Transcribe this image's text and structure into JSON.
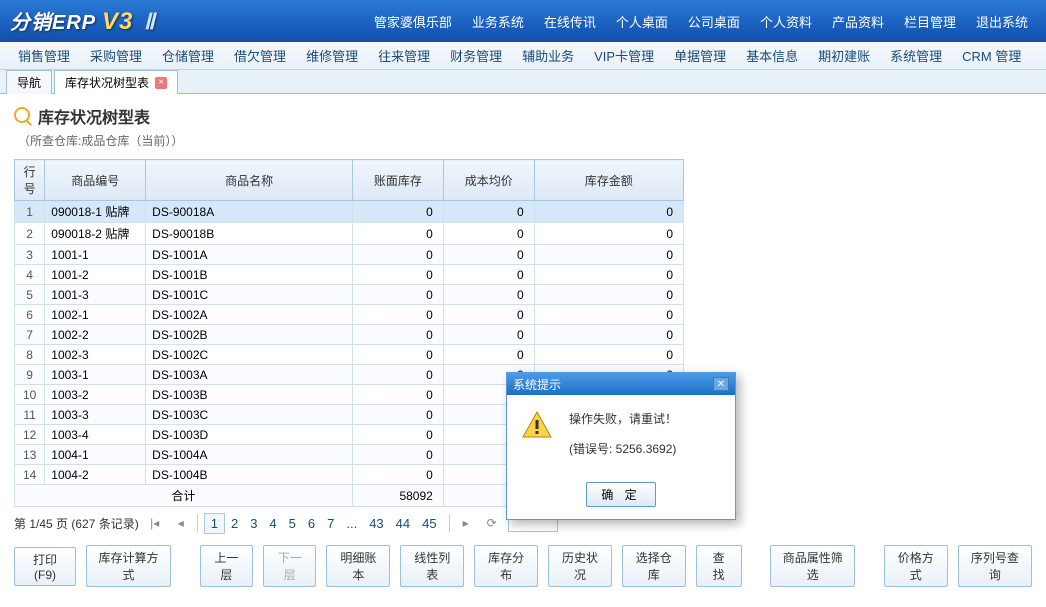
{
  "logo": {
    "text": "分销ERP",
    "v": "V3",
    "suffix": "Ⅱ"
  },
  "topnav": [
    "管家婆俱乐部",
    "业务系统",
    "在线传讯",
    "个人桌面",
    "公司桌面",
    "个人资料",
    "产品资料",
    "栏目管理",
    "退出系统"
  ],
  "menubar": [
    "销售管理",
    "采购管理",
    "仓储管理",
    "借欠管理",
    "维修管理",
    "往来管理",
    "财务管理",
    "辅助业务",
    "VIP卡管理",
    "单据管理",
    "基本信息",
    "期初建账",
    "系统管理",
    "CRM 管理"
  ],
  "tabs": [
    {
      "label": "导航",
      "closable": false,
      "active": false
    },
    {
      "label": "库存状况树型表",
      "closable": true,
      "active": true
    }
  ],
  "page": {
    "title": "库存状况树型表",
    "subtitle": "（所查仓库:成品仓库（当前））"
  },
  "grid": {
    "headers": [
      "行号",
      "商品编号",
      "商品名称",
      "账面库存",
      "成本均价",
      "库存金额"
    ],
    "rows": [
      {
        "n": "1",
        "code": "090018-1 贴牌",
        "name": "DS-90018A",
        "q": "0",
        "p": "0",
        "a": "0",
        "sel": true
      },
      {
        "n": "2",
        "code": "090018-2 贴牌",
        "name": "DS-90018B",
        "q": "0",
        "p": "0",
        "a": "0"
      },
      {
        "n": "3",
        "code": "1001-1",
        "name": "DS-1001A",
        "q": "0",
        "p": "0",
        "a": "0"
      },
      {
        "n": "4",
        "code": "1001-2",
        "name": "DS-1001B",
        "q": "0",
        "p": "0",
        "a": "0"
      },
      {
        "n": "5",
        "code": "1001-3",
        "name": "DS-1001C",
        "q": "0",
        "p": "0",
        "a": "0"
      },
      {
        "n": "6",
        "code": "1002-1",
        "name": "DS-1002A",
        "q": "0",
        "p": "0",
        "a": "0"
      },
      {
        "n": "7",
        "code": "1002-2",
        "name": "DS-1002B",
        "q": "0",
        "p": "0",
        "a": "0"
      },
      {
        "n": "8",
        "code": "1002-3",
        "name": "DS-1002C",
        "q": "0",
        "p": "0",
        "a": "0"
      },
      {
        "n": "9",
        "code": "1003-1",
        "name": "DS-1003A",
        "q": "0",
        "p": "0",
        "a": "0"
      },
      {
        "n": "10",
        "code": "1003-2",
        "name": "DS-1003B",
        "q": "0",
        "p": "0",
        "a": "0"
      },
      {
        "n": "11",
        "code": "1003-3",
        "name": "DS-1003C",
        "q": "0",
        "p": "0",
        "a": "0"
      },
      {
        "n": "12",
        "code": "1003-4",
        "name": "DS-1003D",
        "q": "0",
        "p": "0",
        "a": "0"
      },
      {
        "n": "13",
        "code": "1004-1",
        "name": "DS-1004A",
        "q": "0",
        "p": "0",
        "a": "0"
      },
      {
        "n": "14",
        "code": "1004-2",
        "name": "DS-1004B",
        "q": "0",
        "p": "0",
        "a": "0"
      }
    ],
    "total": {
      "label": "合计",
      "q": "58092"
    }
  },
  "pager": {
    "info": "第 1/45 页 (627 条记录)",
    "pages": [
      "1",
      "2",
      "3",
      "4",
      "5",
      "6",
      "7",
      "...",
      "43",
      "44",
      "45"
    ],
    "current": "1"
  },
  "toolbar": {
    "print": "打印(F9)",
    "calc": "库存计算方式",
    "up": "上一层",
    "down": "下一层",
    "detail": "明细账本",
    "linear": "线性列表",
    "dist": "库存分布",
    "history": "历史状况",
    "select": "选择仓库",
    "find": "查 找",
    "attrfilter": "商品属性筛选",
    "price": "价格方式",
    "serial": "序列号查询"
  },
  "modal": {
    "title": "系统提示",
    "line1": "操作失败，请重试！",
    "line2": "(错误号: 5256.3692)",
    "ok": "确 定"
  }
}
